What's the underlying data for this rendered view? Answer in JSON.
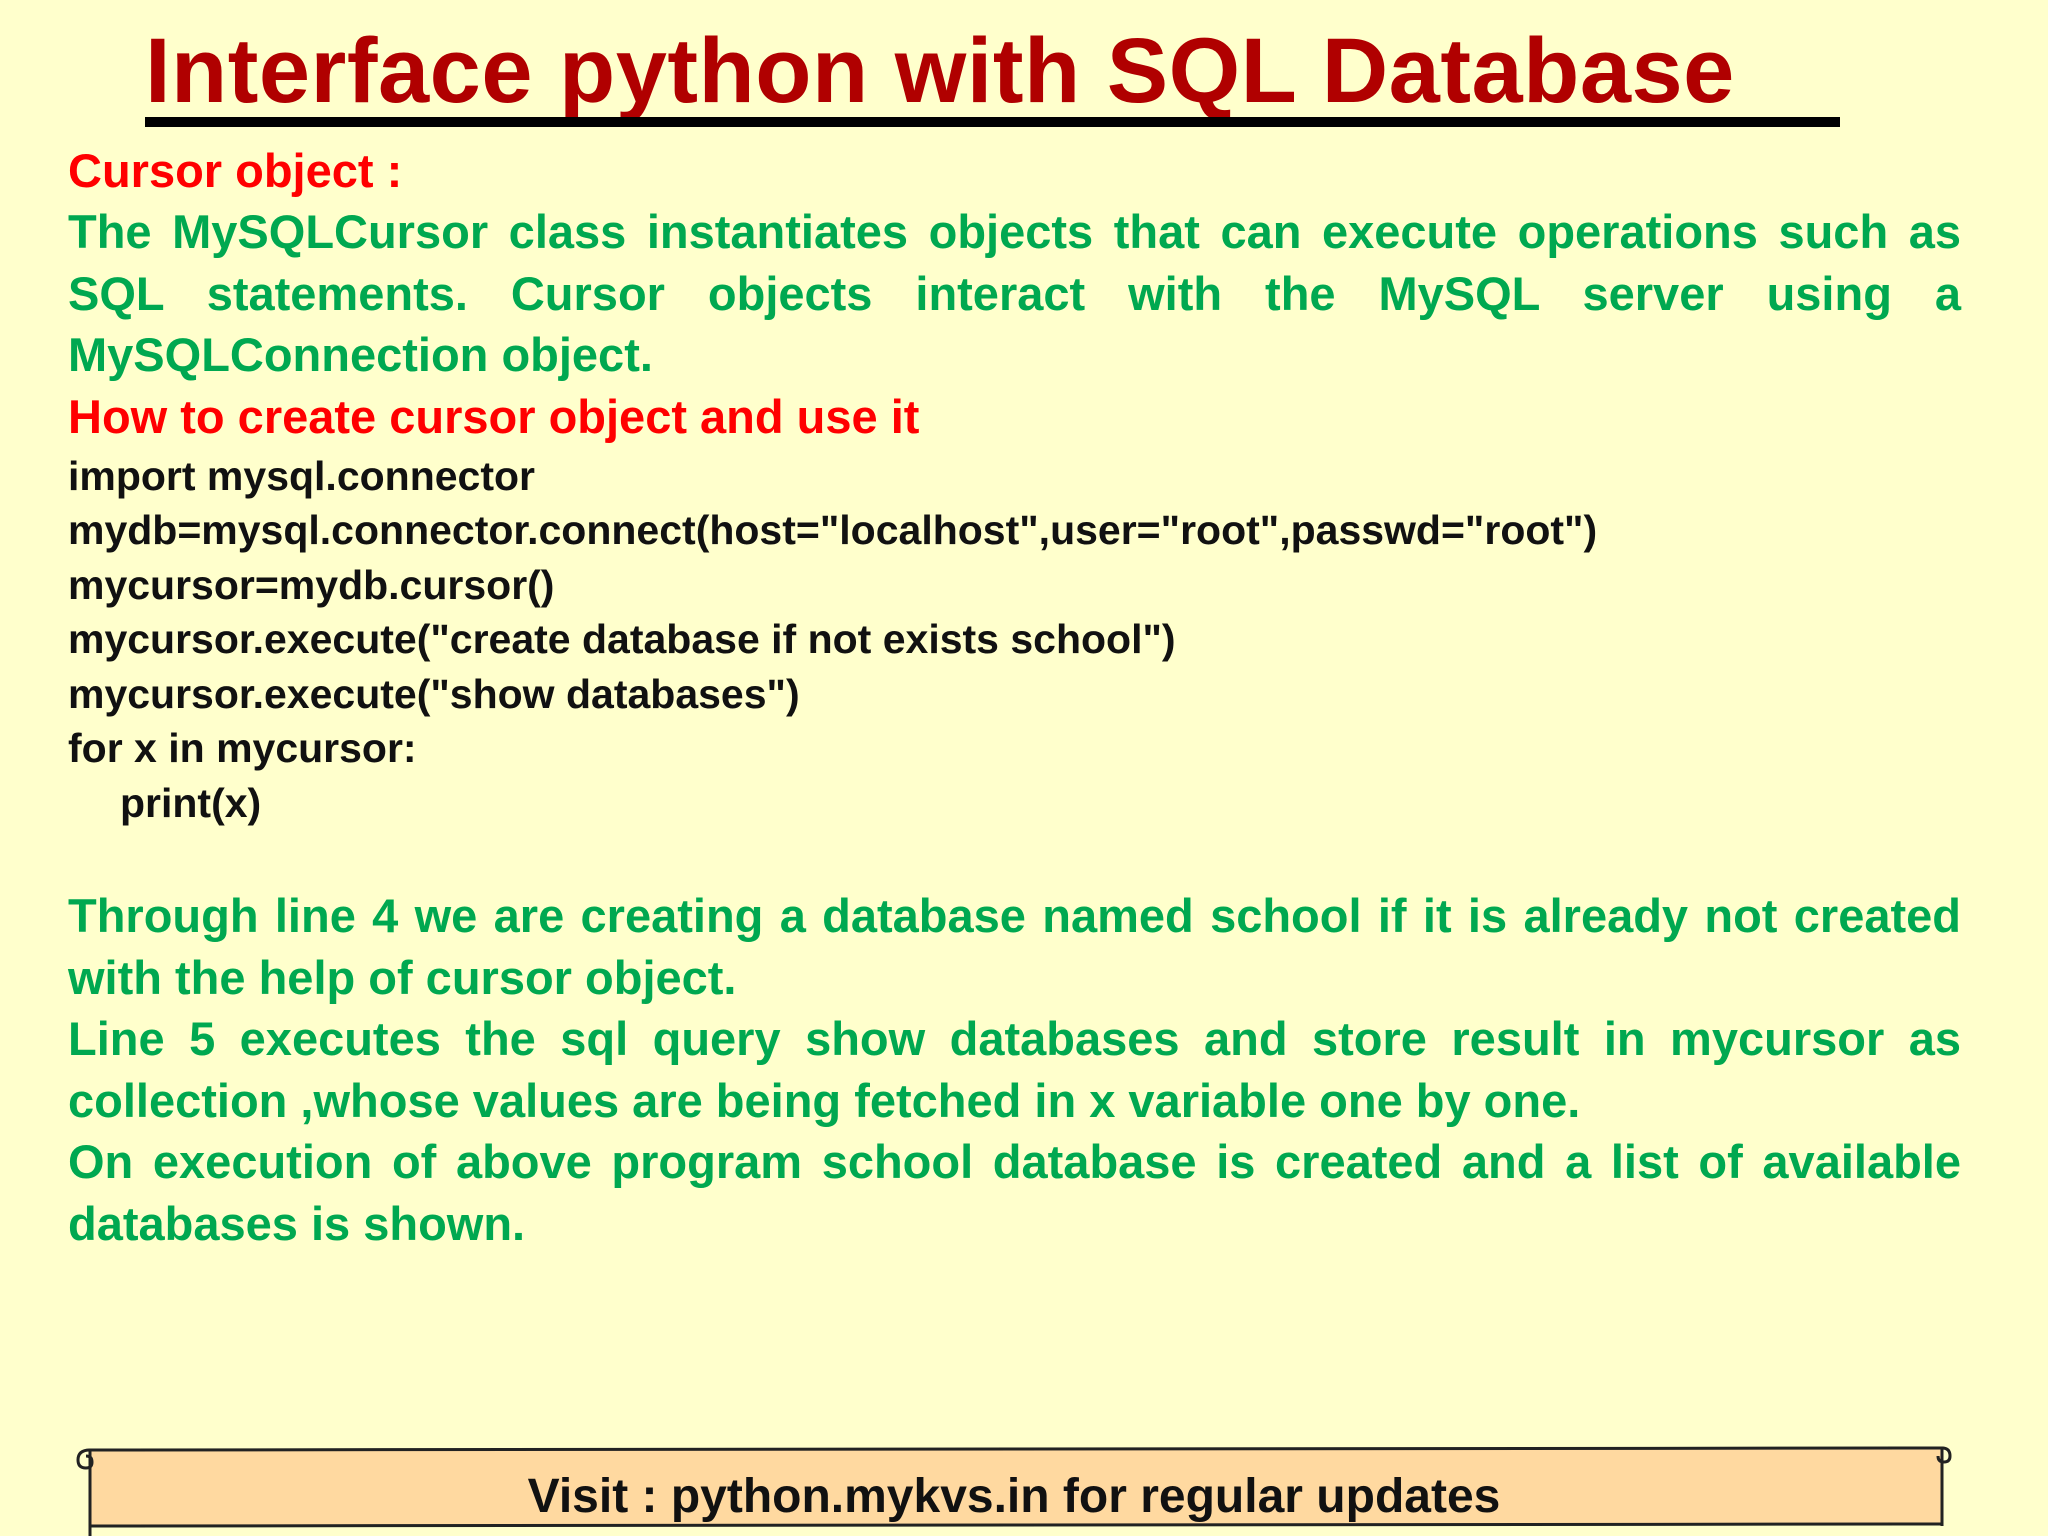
{
  "slide": {
    "title": "Interface python with SQL Database"
  },
  "cursor_section": {
    "heading": "Cursor object :",
    "description": "The MySQLCursor class instantiates objects that can execute operations such as SQL statements. Cursor objects interact with the MySQL server using a MySQLConnection object."
  },
  "howto_section": {
    "heading": "How to create cursor object and use it",
    "code_lines": [
      "import mysql.connector",
      "mydb=mysql.connector.connect(host=\"localhost\",user=\"root\",passwd=\"root\")",
      "mycursor=mydb.cursor()",
      "mycursor.execute(\"create database if not exists school\")",
      "mycursor.execute(\"show databases\")",
      "for x in mycursor:",
      "print(x)"
    ]
  },
  "explanation": {
    "line4": "Through line 4 we are creating a database named school if it is already not created with the help of cursor object.",
    "line5": "Line 5 executes the sql query show databases and store result in mycursor as collection ,whose values are being fetched in x variable one by one.",
    "result": "On execution of above program school database is created and a list of available databases is shown."
  },
  "footer": {
    "text": "Visit : python.mykvs.in for regular updates"
  },
  "colors": {
    "background": "#ffffcc",
    "title": "#b00000",
    "heading": "#ff0000",
    "body_text": "#00a850",
    "code_text": "#111111",
    "footer_fill": "#ffd9a0"
  }
}
